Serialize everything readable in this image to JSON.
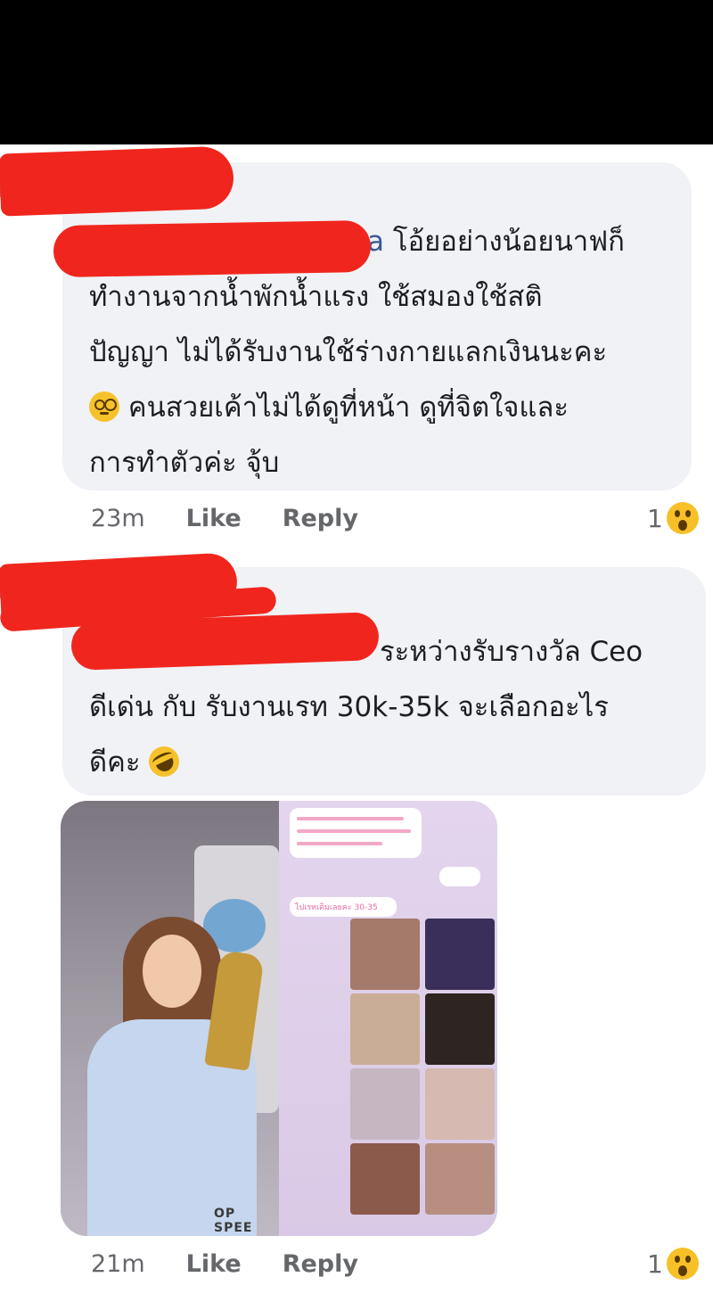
{
  "comments": [
    {
      "author_visible": "a",
      "text_lines": [
        "โอ้ยอย่างน้อยนาฟก็",
        "ทำงานจากน้ำพักน้ำแรง ใช้สมองใช้สติ",
        "ปัญญา ไม่ได้รับงานใช้ร่างกายแลกเงินนะคะ",
        "คนสวยเค้าไม่ได้ดูที่หน้า ดูที่จิตใจและ",
        "การทำตัวค่ะ จุ้บ"
      ],
      "emoji_icon": "woozy-face-emoji",
      "time": "23m",
      "like_label": "Like",
      "reply_label": "Reply",
      "reaction_count": "1",
      "reaction_icon": "wow-reaction-icon"
    },
    {
      "text_lines": [
        "ระหว่างรับรางวัล Ceo",
        "ดีเด่น กับ รับงานเรท 30k-35k จะเลือกอะไร",
        "ดีคะ"
      ],
      "emoji_icon": "rofl-emoji",
      "image": {
        "logo_text": "OP SPEE",
        "chat_snippet": "ไปเรทเดิมเลยคะ 30-35"
      },
      "time": "21m",
      "like_label": "Like",
      "reply_label": "Reply",
      "reaction_count": "1",
      "reaction_icon": "wow-reaction-icon"
    }
  ],
  "colors": {
    "bubble": "#f0f2f5",
    "author_link": "#385898",
    "meta_text": "#65676b",
    "redaction": "#f0261e"
  }
}
